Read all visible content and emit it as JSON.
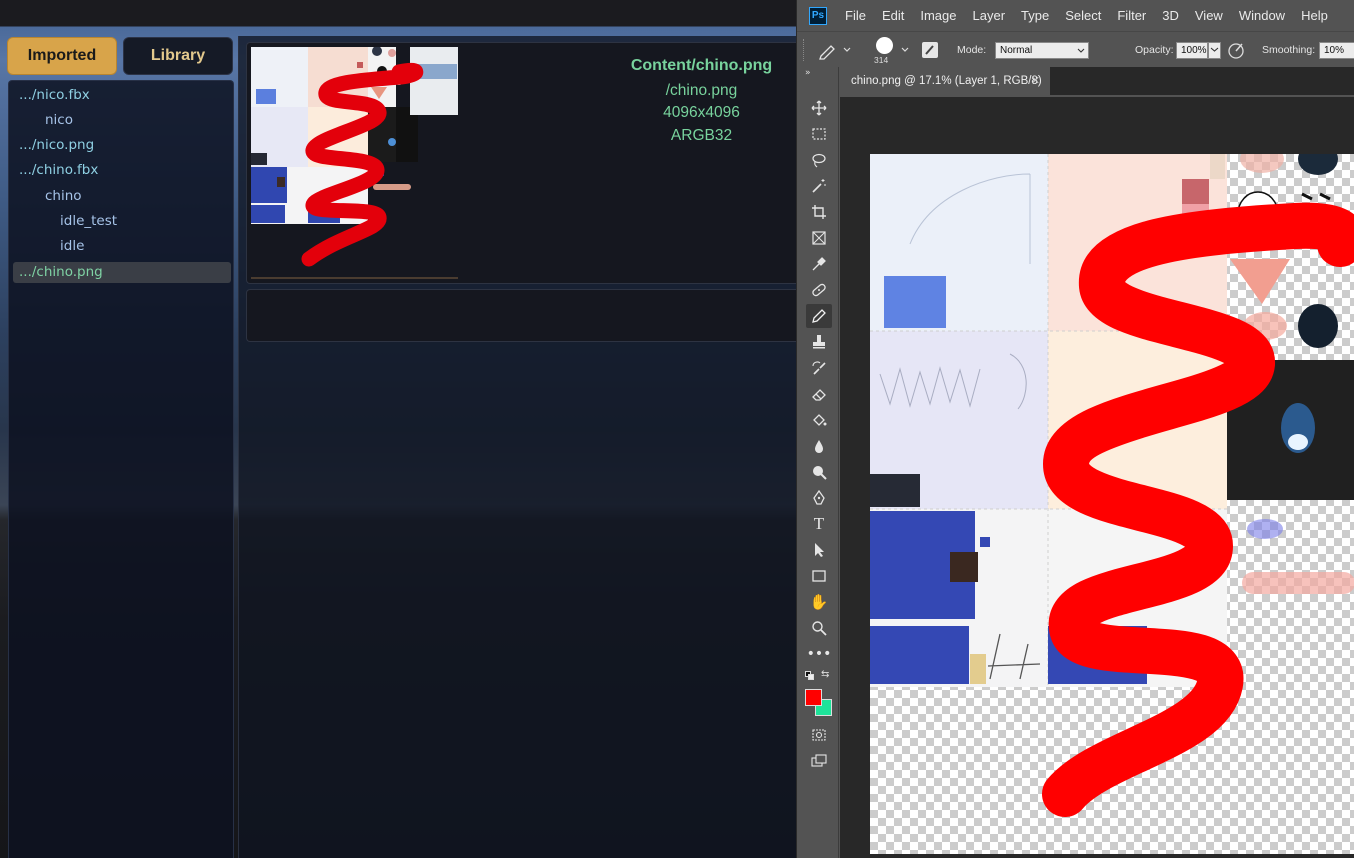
{
  "app": {
    "tabs": {
      "imported": "Imported",
      "library": "Library"
    },
    "tree": [
      {
        "label": ".../nico.fbx",
        "indent": 0,
        "kind": "file"
      },
      {
        "label": "nico",
        "indent": 1,
        "kind": "node"
      },
      {
        "label": ".../nico.png",
        "indent": 0,
        "kind": "file"
      },
      {
        "label": ".../chino.fbx",
        "indent": 0,
        "kind": "file"
      },
      {
        "label": "chino",
        "indent": 1,
        "kind": "node"
      },
      {
        "label": "idle_test",
        "indent": 2,
        "kind": "node"
      },
      {
        "label": "idle",
        "indent": 2,
        "kind": "node"
      },
      {
        "label": ".../chino.png",
        "indent": 0,
        "kind": "file",
        "selected": true
      }
    ],
    "asset_info": {
      "path": "Content/chino.png",
      "name": "/chino.png",
      "size": "4096x4096",
      "format": "ARGB32"
    },
    "colors": {
      "accent": "#d8a44a",
      "info_text": "#78d39d"
    }
  },
  "photoshop": {
    "logo": "Ps",
    "menu": [
      "File",
      "Edit",
      "Image",
      "Layer",
      "Type",
      "Select",
      "Filter",
      "3D",
      "View",
      "Window",
      "Help"
    ],
    "options": {
      "brush_size": "314",
      "mode_label": "Mode:",
      "mode_value": "Normal",
      "opacity_label": "Opacity:",
      "opacity_value": "100%",
      "smoothing_label": "Smoothing:",
      "smoothing_value": "10%"
    },
    "document_tab": "chino.png @ 17.1% (Layer 1, RGB/8)",
    "tools": [
      "move-icon",
      "marquee-icon",
      "lasso-icon",
      "magic-wand-icon",
      "crop-icon",
      "frame-icon",
      "eyedropper-icon",
      "healing-brush-icon",
      "pencil-icon",
      "clone-stamp-icon",
      "history-brush-icon",
      "eraser-icon",
      "paint-bucket-icon",
      "blur-icon",
      "dodge-icon",
      "pen-icon",
      "type-icon",
      "path-select-icon",
      "rectangle-icon",
      "hand-icon",
      "zoom-icon",
      "more-tools-icon"
    ],
    "foreground_color": "#ff0000",
    "background_color": "#1ee39a"
  }
}
